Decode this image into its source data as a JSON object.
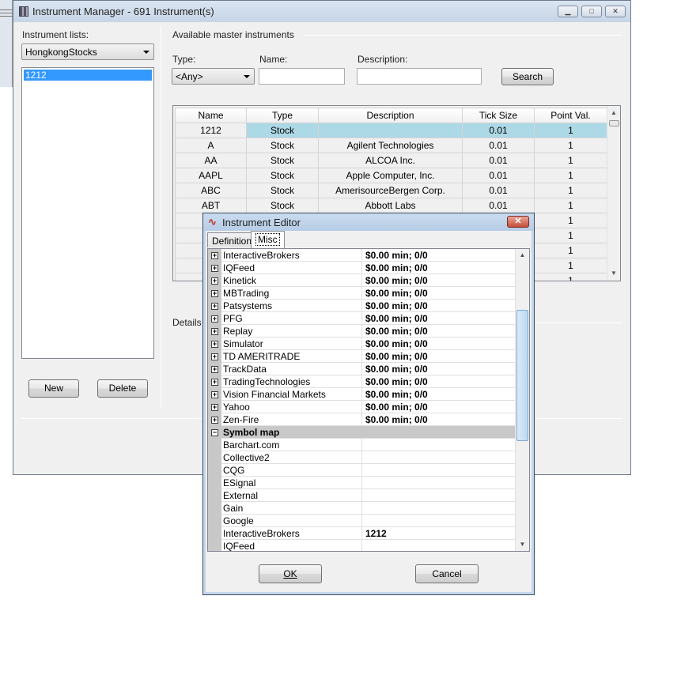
{
  "main_window": {
    "title": "Instrument Manager - 691 Instrument(s)",
    "instrument_lists_label": "Instrument lists:",
    "selected_list": "HongkongStocks",
    "list_items": [
      "1212"
    ],
    "new_button": "New",
    "delete_button": "Delete",
    "available_label": "Available master instruments",
    "type_label": "Type:",
    "type_value": "<Any>",
    "name_label": "Name:",
    "name_value": "",
    "description_label": "Description:",
    "description_value": "",
    "search_button": "Search",
    "details_label": "Details",
    "table": {
      "columns": [
        "Name",
        "Type",
        "Description",
        "Tick Size",
        "Point Val."
      ],
      "rows": [
        [
          "1212",
          "Stock",
          "",
          "0.01",
          "1"
        ],
        [
          "A",
          "Stock",
          "Agilent Technologies",
          "0.01",
          "1"
        ],
        [
          "AA",
          "Stock",
          "ALCOA Inc.",
          "0.01",
          "1"
        ],
        [
          "AAPL",
          "Stock",
          "Apple Computer, Inc.",
          "0.01",
          "1"
        ],
        [
          "ABC",
          "Stock",
          "AmerisourceBergen Corp.",
          "0.01",
          "1"
        ],
        [
          "ABT",
          "Stock",
          "Abbott Labs",
          "0.01",
          "1"
        ],
        [
          "",
          "",
          "",
          "",
          "1"
        ],
        [
          "",
          "",
          "",
          "",
          "1"
        ],
        [
          "",
          "",
          "",
          "",
          "1"
        ],
        [
          "",
          "",
          "",
          "",
          "1"
        ],
        [
          "",
          "",
          "",
          "",
          "1"
        ]
      ],
      "selected_row_color": "#add8e6"
    }
  },
  "editor": {
    "title": "Instrument Editor",
    "tabs": [
      "Definition",
      "Misc"
    ],
    "active_tab": "Misc",
    "providers": [
      {
        "name": "InteractiveBrokers",
        "value": "$0.00 min;  0/0"
      },
      {
        "name": "IQFeed",
        "value": "$0.00 min;  0/0"
      },
      {
        "name": "Kinetick",
        "value": "$0.00 min;  0/0"
      },
      {
        "name": "MBTrading",
        "value": "$0.00 min;  0/0"
      },
      {
        "name": "Patsystems",
        "value": "$0.00 min;  0/0"
      },
      {
        "name": "PFG",
        "value": "$0.00 min;  0/0"
      },
      {
        "name": "Replay",
        "value": "$0.00 min;  0/0"
      },
      {
        "name": "Simulator",
        "value": "$0.00 min;  0/0"
      },
      {
        "name": "TD AMERITRADE",
        "value": "$0.00 min;  0/0"
      },
      {
        "name": "TrackData",
        "value": "$0.00 min;  0/0"
      },
      {
        "name": "TradingTechnologies",
        "value": "$0.00 min;  0/0"
      },
      {
        "name": "Vision Financial Markets",
        "value": "$0.00 min;  0/0"
      },
      {
        "name": "Yahoo",
        "value": "$0.00 min;  0/0"
      },
      {
        "name": "Zen-Fire",
        "value": "$0.00 min;  0/0"
      }
    ],
    "symbol_map_label": "Symbol map",
    "symbol_map": [
      {
        "name": "Barchart.com",
        "value": ""
      },
      {
        "name": "Collective2",
        "value": ""
      },
      {
        "name": "CQG",
        "value": ""
      },
      {
        "name": "ESignal",
        "value": ""
      },
      {
        "name": "External",
        "value": ""
      },
      {
        "name": "Gain",
        "value": ""
      },
      {
        "name": "Google",
        "value": ""
      },
      {
        "name": "InteractiveBrokers",
        "value": "1212"
      },
      {
        "name": "IQFeed",
        "value": ""
      }
    ],
    "ok_button": "OK",
    "cancel_button": "Cancel"
  }
}
